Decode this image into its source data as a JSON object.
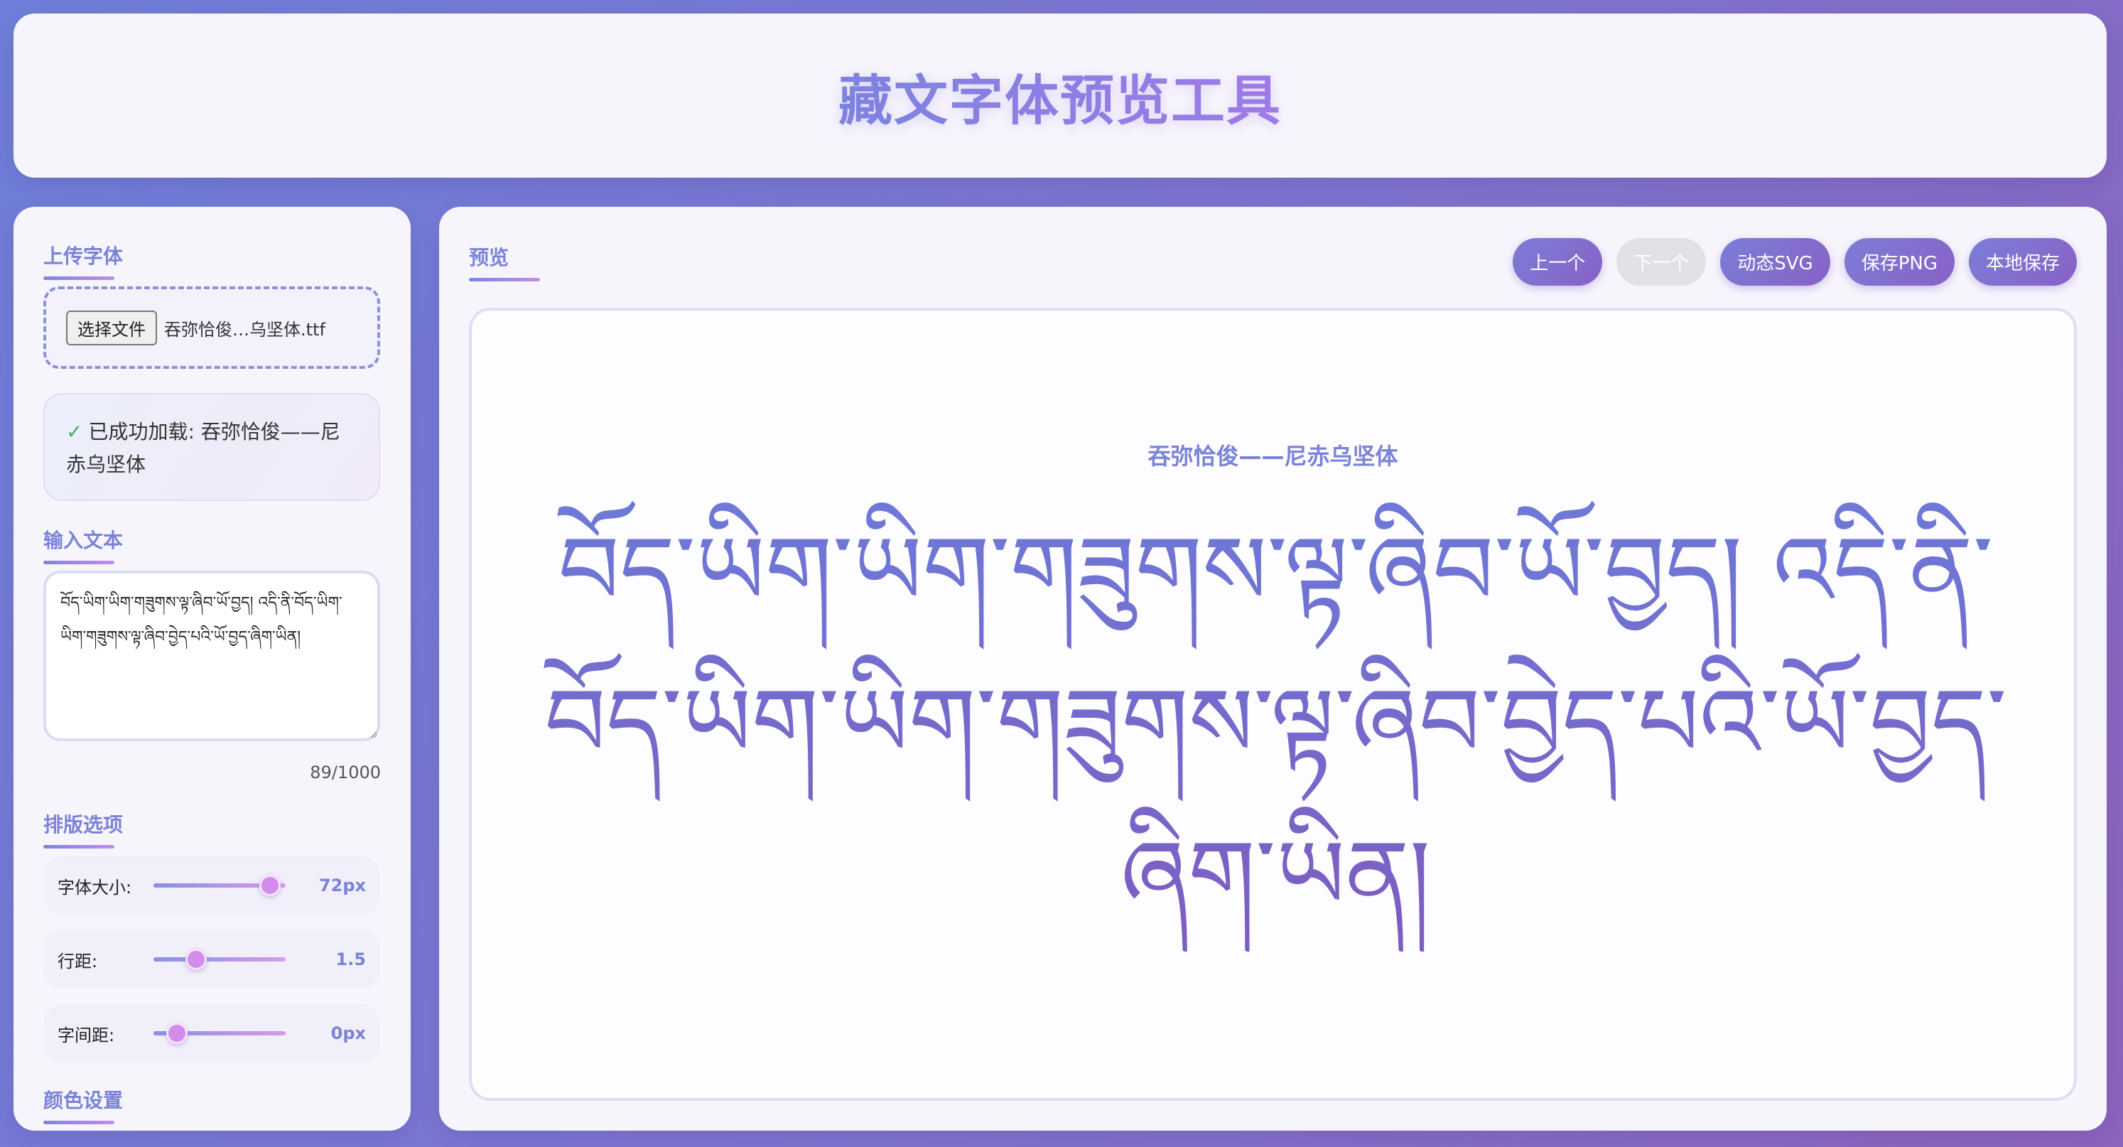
{
  "header": {
    "title": "藏文字体预览工具"
  },
  "sidebar": {
    "upload": {
      "title": "上传字体",
      "button_label": "选择文件",
      "file_name": "吞弥恰俊…乌坚体.ttf"
    },
    "status": {
      "check": "✓",
      "text": "已成功加载: 吞弥恰俊——尼赤乌坚体"
    },
    "input": {
      "title": "输入文本",
      "value": "བོད་ཡིག་ཡིག་གཟུགས་ལྟ་ཞིབ་ཡོ་བྱད། འདི་ནི་བོད་ཡིག་ཡིག་གཟུགས་ལྟ་ཞིབ་བྱེད་པའི་ཡོ་བྱད་ཞིག་ཡིན།",
      "counter": "89/1000"
    },
    "layout": {
      "title": "排版选项",
      "font_size": {
        "label": "字体大小:",
        "value": "72px",
        "fraction": 0.88
      },
      "line_height": {
        "label": "行距:",
        "value": "1.5",
        "fraction": 0.32
      },
      "letter_spacing": {
        "label": "字间距:",
        "value": "0px",
        "fraction": 0.18
      }
    },
    "color": {
      "title": "颜色设置"
    }
  },
  "main": {
    "title": "预览",
    "toolbar": {
      "prev": "上一个",
      "next": "下一个",
      "svg": "动态SVG",
      "png": "保存PNG",
      "save": "本地保存"
    },
    "preview": {
      "font_name": "吞弥恰俊——尼赤乌坚体",
      "text": "བོད་ཡིག་ཡིག་གཟུགས་ལྟ་ཞིབ་ཡོ་བྱད། འདི་ནི་བོད་ཡིག་ཡིག་གཟུགས་ལྟ་ཞིབ་བྱེད་པའི་ཡོ་བྱད་ཞིག་ཡིན།"
    }
  },
  "colors": {
    "accent": "#7a83d8",
    "gradient_start": "#6d79d8",
    "gradient_end": "#7d5cc0",
    "success": "#3cae6a"
  }
}
